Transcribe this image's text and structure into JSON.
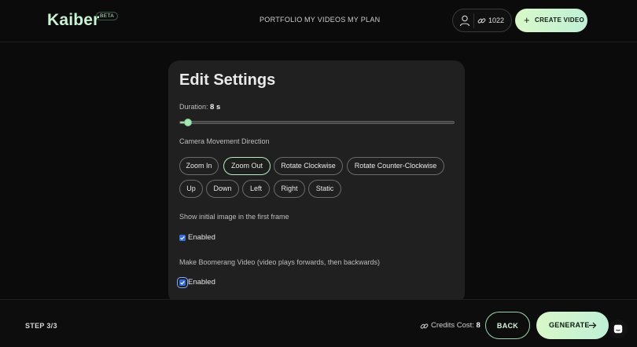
{
  "brand": {
    "name": "Kaiber",
    "badge": "BETA"
  },
  "nav": [
    {
      "label": "PORTFOLIO"
    },
    {
      "label": "MY VIDEOS"
    },
    {
      "label": "MY PLAN"
    }
  ],
  "account": {
    "credits": "1022",
    "user_icon": "user-icon",
    "credits_icon": "link-icon"
  },
  "create_button": {
    "label": "CREATE VIDEO",
    "icon": "plus-icon"
  },
  "settings": {
    "title": "Edit Settings",
    "duration": {
      "label": "Duration:",
      "value": "8 s",
      "slider_fraction": 0.03
    },
    "camera": {
      "label": "Camera Movement Direction",
      "options": [
        {
          "label": "Zoom In",
          "selected": false
        },
        {
          "label": "Zoom Out",
          "selected": true
        },
        {
          "label": "Rotate Clockwise",
          "selected": false
        },
        {
          "label": "Rotate Counter-Clockwise",
          "selected": false
        },
        {
          "label": "Up",
          "selected": false
        },
        {
          "label": "Down",
          "selected": false
        },
        {
          "label": "Left",
          "selected": false
        },
        {
          "label": "Right",
          "selected": false
        },
        {
          "label": "Static",
          "selected": false
        }
      ]
    },
    "initial_image": {
      "label": "Show initial image in the first frame",
      "checkbox_label": "Enabled",
      "checked": true
    },
    "boomerang": {
      "label": "Make Boomerang Video (video plays forwards, then backwards)",
      "checkbox_label": "Enabled",
      "checked": true
    }
  },
  "footer": {
    "step": "STEP 3/3",
    "credits_cost_label": "Credits Cost:",
    "credits_cost_value": "8",
    "back_label": "BACK",
    "generate_label": "GENERATE"
  },
  "colors": {
    "accent": "#c9f3d4",
    "checkbox": "#2f6fe0",
    "background": "#0b0b0b",
    "card": "#202020"
  }
}
